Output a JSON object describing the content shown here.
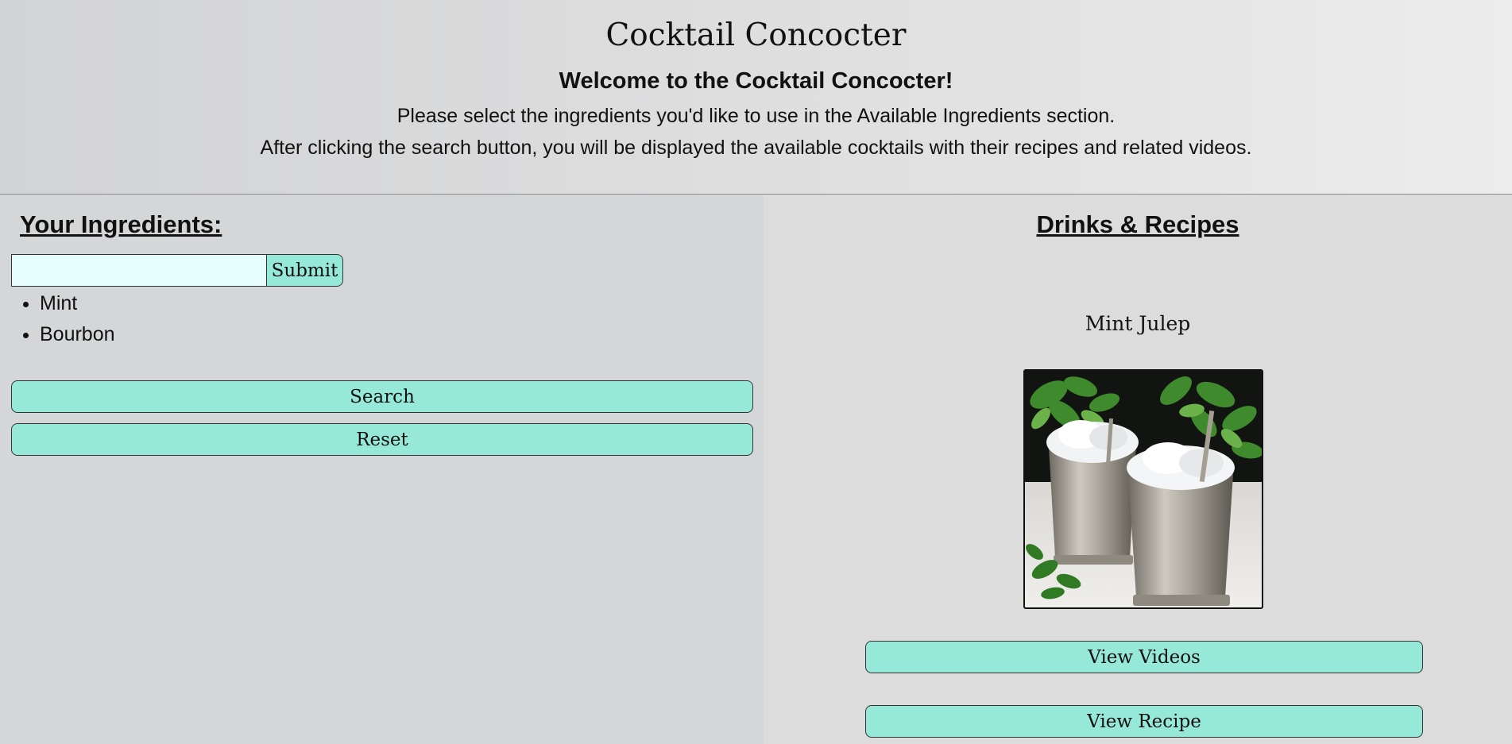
{
  "header": {
    "app_title": "Cocktail Concocter",
    "welcome": "Welcome to the Cocktail Concocter!",
    "instruction_1": "Please select the ingredients you'd like to use in the Available Ingredients section.",
    "instruction_2": "After clicking the search button, you will be displayed the available cocktails with their recipes and related videos."
  },
  "ingredients_panel": {
    "title": "Your Ingredients:",
    "input_value": "",
    "submit_label": "Submit",
    "items": [
      "Mint",
      "Bourbon"
    ],
    "search_label": "Search",
    "reset_label": "Reset"
  },
  "drinks_panel": {
    "title": "Drinks & Recipes",
    "drinks": [
      {
        "name": "Mint Julep",
        "image": "mint-julep-photo",
        "view_videos_label": "View Videos",
        "view_recipe_label": "View Recipe"
      }
    ]
  },
  "colors": {
    "button_bg": "#96e9d8",
    "input_bg": "#e6fffe",
    "left_panel_bg": "#d5d6d8",
    "right_panel_bg": "#dcdcdd"
  }
}
